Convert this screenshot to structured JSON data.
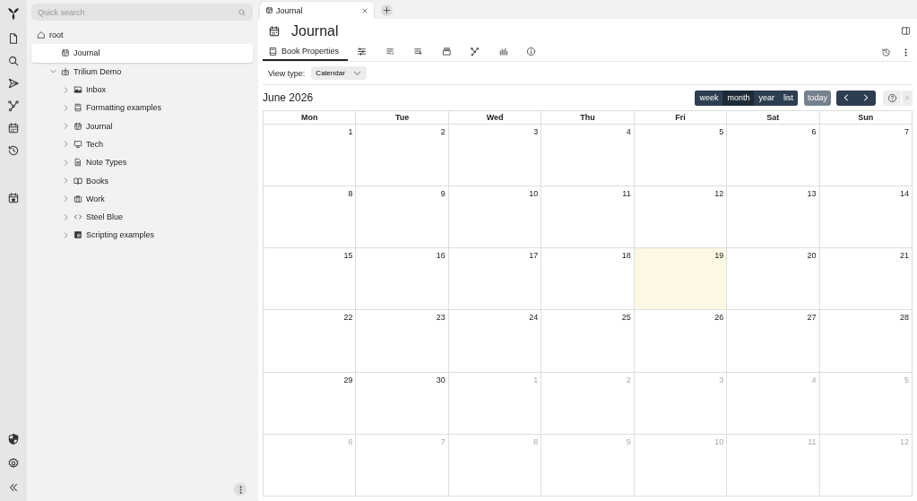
{
  "launcher": [
    {
      "kind": "file"
    },
    {
      "kind": "search"
    },
    {
      "kind": "send"
    },
    {
      "kind": "graph"
    },
    {
      "kind": "calendar"
    },
    {
      "kind": "history"
    },
    {
      "kind": "today"
    }
  ],
  "launcher_bottom": [
    {
      "kind": "shield"
    },
    {
      "kind": "settings"
    },
    {
      "kind": "collapse"
    }
  ],
  "search": {
    "placeholder": "Quick search"
  },
  "tree": [
    {
      "label": "root",
      "kind": "home",
      "selected": false,
      "children": [
        {
          "label": "Journal",
          "kind": "calendar",
          "selected": true
        },
        {
          "label": "Trilium Demo",
          "kind": "demo",
          "selected": false,
          "expanded": true,
          "children": [
            {
              "label": "Inbox",
              "kind": "image",
              "selected": false,
              "expanded": false
            },
            {
              "label": "Formatting examples",
              "kind": "book",
              "selected": false,
              "expanded": false
            },
            {
              "label": "Journal",
              "kind": "calendar",
              "selected": false,
              "expanded": false
            },
            {
              "label": "Tech",
              "kind": "monitor",
              "selected": false,
              "expanded": false
            },
            {
              "label": "Note Types",
              "kind": "doc",
              "selected": false,
              "expanded": false
            },
            {
              "label": "Books",
              "kind": "openbook",
              "selected": false,
              "expanded": false
            },
            {
              "label": "Work",
              "kind": "briefcase",
              "selected": false,
              "expanded": false
            },
            {
              "label": "Steel Blue",
              "kind": "code",
              "selected": false,
              "expanded": false
            },
            {
              "label": "Scripting examples",
              "kind": "script",
              "selected": false,
              "expanded": false
            }
          ]
        }
      ]
    }
  ],
  "tabs": [
    {
      "title": "Journal",
      "selected": true
    }
  ],
  "note": {
    "title": "Journal"
  },
  "ribbon": [
    {
      "kind": "book",
      "label": "Book Properties",
      "selected": true
    },
    {
      "kind": "sliders",
      "selected": false
    },
    {
      "kind": "listcheck",
      "selected": false
    },
    {
      "kind": "listplus",
      "selected": false
    },
    {
      "kind": "stack",
      "selected": false
    },
    {
      "kind": "graph",
      "selected": false
    },
    {
      "kind": "bars",
      "selected": false
    },
    {
      "kind": "info",
      "selected": false
    }
  ],
  "view_type": {
    "label": "View type:",
    "value": "Calendar"
  },
  "calendar": {
    "title": "June 2026",
    "views": [
      {
        "label": "week",
        "selected": false
      },
      {
        "label": "month",
        "selected": true
      },
      {
        "label": "year",
        "selected": false
      },
      {
        "label": "list",
        "selected": false
      }
    ],
    "today_button": "today",
    "today_disabled": true,
    "weekdays": [
      "Mon",
      "Tue",
      "Wed",
      "Thu",
      "Fri",
      "Sat",
      "Sun"
    ],
    "weeks": [
      [
        {
          "day": "1",
          "other_month": false,
          "today": false
        },
        {
          "day": "2",
          "other_month": false,
          "today": false
        },
        {
          "day": "3",
          "other_month": false,
          "today": false
        },
        {
          "day": "4",
          "other_month": false,
          "today": false
        },
        {
          "day": "5",
          "other_month": false,
          "today": false
        },
        {
          "day": "6",
          "other_month": false,
          "today": false
        },
        {
          "day": "7",
          "other_month": false,
          "today": false
        }
      ],
      [
        {
          "day": "8",
          "other_month": false,
          "today": false
        },
        {
          "day": "9",
          "other_month": false,
          "today": false
        },
        {
          "day": "10",
          "other_month": false,
          "today": false
        },
        {
          "day": "11",
          "other_month": false,
          "today": false
        },
        {
          "day": "12",
          "other_month": false,
          "today": false
        },
        {
          "day": "13",
          "other_month": false,
          "today": false
        },
        {
          "day": "14",
          "other_month": false,
          "today": false
        }
      ],
      [
        {
          "day": "15",
          "other_month": false,
          "today": false
        },
        {
          "day": "16",
          "other_month": false,
          "today": false
        },
        {
          "day": "17",
          "other_month": false,
          "today": false
        },
        {
          "day": "18",
          "other_month": false,
          "today": false
        },
        {
          "day": "19",
          "other_month": false,
          "today": true
        },
        {
          "day": "20",
          "other_month": false,
          "today": false
        },
        {
          "day": "21",
          "other_month": false,
          "today": false
        }
      ],
      [
        {
          "day": "22",
          "other_month": false,
          "today": false
        },
        {
          "day": "23",
          "other_month": false,
          "today": false
        },
        {
          "day": "24",
          "other_month": false,
          "today": false
        },
        {
          "day": "25",
          "other_month": false,
          "today": false
        },
        {
          "day": "26",
          "other_month": false,
          "today": false
        },
        {
          "day": "27",
          "other_month": false,
          "today": false
        },
        {
          "day": "28",
          "other_month": false,
          "today": false
        }
      ],
      [
        {
          "day": "29",
          "other_month": false,
          "today": false
        },
        {
          "day": "30",
          "other_month": false,
          "today": false
        },
        {
          "day": "1",
          "other_month": true,
          "today": false
        },
        {
          "day": "2",
          "other_month": true,
          "today": false
        },
        {
          "day": "3",
          "other_month": true,
          "today": false
        },
        {
          "day": "4",
          "other_month": true,
          "today": false
        },
        {
          "day": "5",
          "other_month": true,
          "today": false
        }
      ],
      [
        {
          "day": "6",
          "other_month": true,
          "today": false
        },
        {
          "day": "7",
          "other_month": true,
          "today": false
        },
        {
          "day": "8",
          "other_month": true,
          "today": false
        },
        {
          "day": "9",
          "other_month": true,
          "today": false
        },
        {
          "day": "10",
          "other_month": true,
          "today": false
        },
        {
          "day": "11",
          "other_month": true,
          "today": false
        },
        {
          "day": "12",
          "other_month": true,
          "today": false
        }
      ]
    ]
  }
}
